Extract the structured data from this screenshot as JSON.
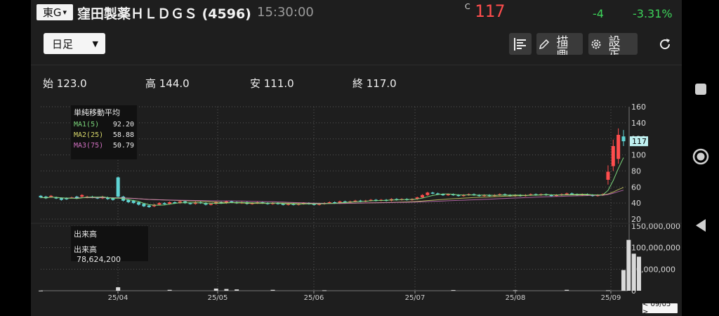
{
  "header": {
    "market": "東G",
    "stock_name": "窪田製薬ＨＬＤＧＳ (4596)",
    "time": "15:30:00",
    "close_flag": "C",
    "price": "117",
    "change": "-4",
    "change_pct": "-3.31%"
  },
  "toolbar": {
    "period": "日足",
    "draw_label": "描画",
    "settings_label": "設定"
  },
  "ohlc": {
    "open": "始 123.0",
    "high": "高 144.0",
    "low": "安 111.0",
    "close": "終 117.0"
  },
  "legend": {
    "title": "単純移動平均",
    "ma1_label": "MA1(5)",
    "ma1_value": "92.20",
    "ma2_label": "MA2(25)",
    "ma2_value": "58.88",
    "ma3_label": "MA3(75)",
    "ma3_value": "50.79"
  },
  "volume_legend": {
    "title": "出来高",
    "label": "出来高",
    "value": "78,624,200"
  },
  "cursor_date": "< 09/05 >",
  "last_price_tag": "117",
  "colors": {
    "up": "#ff4d4d",
    "down": "#5fd4d4",
    "ma1": "#7bd67b",
    "ma2": "#d8d86a",
    "ma3": "#d070c0",
    "grid": "#555555"
  },
  "chart_data": {
    "type": "candlestick",
    "x_ticks": [
      "25/04",
      "25/05",
      "25/06",
      "25/07",
      "25/08",
      "25/09"
    ],
    "price_axis": {
      "ticks": [
        160,
        140,
        120,
        100,
        80,
        60,
        40,
        20
      ],
      "ylim": [
        20,
        160
      ]
    },
    "volume_axis": {
      "ticks": [
        "150,000,000",
        "100,000,000",
        "50,000,000",
        "0"
      ],
      "ylim": [
        0,
        150000000
      ]
    },
    "price_path": [
      [
        49,
        47
      ],
      [
        48,
        46
      ],
      [
        48,
        49
      ],
      [
        47,
        46
      ],
      [
        46,
        44
      ],
      [
        46,
        45
      ],
      [
        47,
        47
      ],
      [
        48,
        46
      ],
      [
        48,
        50
      ],
      [
        47,
        48
      ],
      [
        48,
        47
      ],
      [
        47,
        46
      ],
      [
        46,
        48
      ],
      [
        47,
        45
      ],
      [
        46,
        44
      ],
      [
        72,
        48
      ],
      [
        48,
        43
      ],
      [
        44,
        41
      ],
      [
        43,
        40
      ],
      [
        41,
        38
      ],
      [
        39,
        36
      ],
      [
        37,
        35
      ],
      [
        36,
        38
      ],
      [
        38,
        40
      ],
      [
        40,
        39
      ],
      [
        39,
        41
      ],
      [
        41,
        40
      ],
      [
        40,
        42
      ],
      [
        42,
        40
      ],
      [
        40,
        39
      ],
      [
        39,
        41
      ],
      [
        41,
        40
      ],
      [
        40,
        38
      ],
      [
        38,
        39
      ],
      [
        39,
        41
      ],
      [
        41,
        40
      ],
      [
        40,
        42
      ],
      [
        42,
        41
      ],
      [
        41,
        40
      ],
      [
        40,
        41
      ],
      [
        41,
        39
      ],
      [
        39,
        40
      ],
      [
        40,
        41
      ],
      [
        41,
        40
      ],
      [
        40,
        39
      ],
      [
        39,
        40
      ],
      [
        40,
        39
      ],
      [
        39,
        38
      ],
      [
        38,
        39
      ],
      [
        39,
        38
      ],
      [
        38,
        39
      ],
      [
        39,
        40
      ],
      [
        40,
        39
      ],
      [
        39,
        38
      ],
      [
        38,
        39
      ],
      [
        39,
        40
      ],
      [
        40,
        41
      ],
      [
        41,
        40
      ],
      [
        40,
        42
      ],
      [
        42,
        41
      ],
      [
        41,
        42
      ],
      [
        42,
        43
      ],
      [
        43,
        42
      ],
      [
        42,
        43
      ],
      [
        43,
        44
      ],
      [
        44,
        43
      ],
      [
        43,
        44
      ],
      [
        44,
        43
      ],
      [
        43,
        45
      ],
      [
        45,
        44
      ],
      [
        44,
        45
      ],
      [
        45,
        44
      ],
      [
        44,
        45
      ],
      [
        45,
        47
      ],
      [
        47,
        50
      ],
      [
        50,
        53
      ],
      [
        53,
        52
      ],
      [
        52,
        51
      ],
      [
        51,
        50
      ],
      [
        50,
        51
      ],
      [
        51,
        50
      ],
      [
        50,
        49
      ],
      [
        49,
        50
      ],
      [
        50,
        51
      ],
      [
        51,
        50
      ],
      [
        50,
        49
      ],
      [
        49,
        50
      ],
      [
        50,
        49
      ],
      [
        49,
        50
      ],
      [
        50,
        51
      ],
      [
        51,
        50
      ],
      [
        50,
        49
      ],
      [
        49,
        50
      ],
      [
        50,
        49
      ],
      [
        49,
        50
      ],
      [
        50,
        51
      ],
      [
        51,
        50
      ],
      [
        50,
        51
      ],
      [
        51,
        50
      ],
      [
        50,
        49
      ],
      [
        49,
        50
      ],
      [
        50,
        51
      ],
      [
        51,
        52
      ],
      [
        52,
        51
      ],
      [
        51,
        50
      ],
      [
        50,
        51
      ],
      [
        51,
        50
      ],
      [
        50,
        49
      ],
      [
        49,
        50
      ],
      [
        50,
        51
      ],
      [
        69,
        79
      ],
      [
        86,
        111
      ],
      [
        95,
        125
      ],
      [
        123,
        117
      ]
    ],
    "volume_bars": [
      [
        0,
        0.3
      ],
      [
        15,
        8
      ],
      [
        25,
        2
      ],
      [
        34,
        5
      ],
      [
        36,
        4
      ],
      [
        38,
        3
      ],
      [
        45,
        2
      ],
      [
        55,
        1
      ],
      [
        80,
        1.5
      ],
      [
        92,
        1
      ],
      [
        102,
        2
      ],
      [
        110,
        1
      ],
      [
        113,
        48
      ],
      [
        114,
        118
      ],
      [
        115,
        86
      ],
      [
        116,
        79
      ]
    ]
  }
}
